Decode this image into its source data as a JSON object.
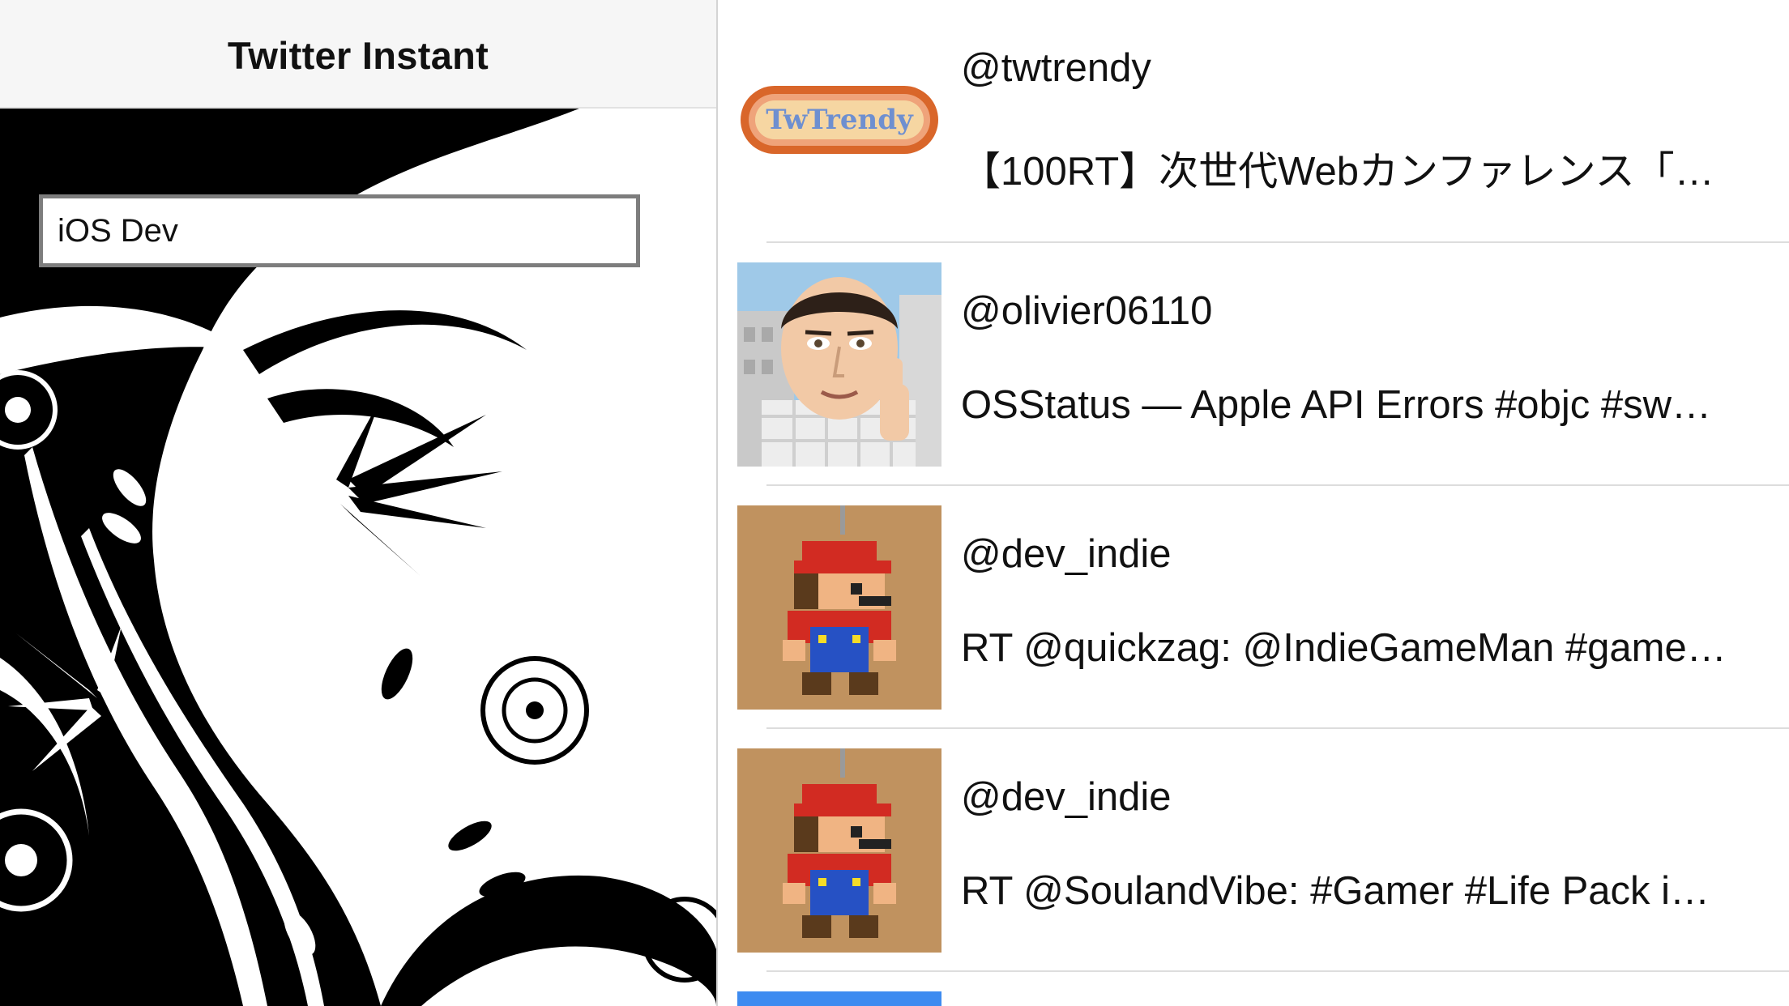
{
  "app": {
    "title": "Twitter Instant"
  },
  "search": {
    "value": "iOS Dev"
  },
  "tweets": [
    {
      "handle": "@twtrendy",
      "text": "【100RT】次世代Webカンファレンス「…",
      "avatar": "twtrendy-logo-avatar"
    },
    {
      "handle": "@olivier06110",
      "text": "OSStatus — Apple API Errors #objc #sw…",
      "avatar": "cartoon-man-thumbs-up-avatar"
    },
    {
      "handle": "@dev_indie",
      "text": "RT @quickzag: @IndieGameMan #game…",
      "avatar": "pixel-mario-keychain-avatar"
    },
    {
      "handle": "@dev_indie",
      "text": "RT @SoulandVibe: #Gamer #Life Pack i…",
      "avatar": "pixel-mario-keychain-avatar"
    }
  ],
  "colors": {
    "navbar": "#f6f6f6",
    "separator": "#dddddd",
    "search_border": "#7d7d7d",
    "peek_avatar": "#3d8bf0"
  }
}
